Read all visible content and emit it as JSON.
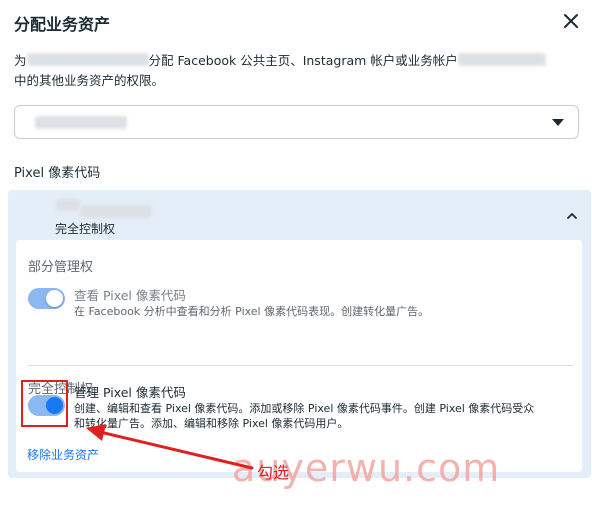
{
  "dialog": {
    "title": "分配业务资产",
    "desc_prefix": "为",
    "desc_middle": "分配 Facebook 公共主页、Instagram 帐户或业务帐户",
    "desc_suffix": "中的其他业务资产的权限。"
  },
  "section": {
    "label": "Pixel 像素代码"
  },
  "panel": {
    "role_label": "完全控制权",
    "partial": {
      "title": "部分管理权",
      "permission_name": "查看 Pixel 像素代码",
      "permission_desc": "在 Facebook 分析中查看和分析 Pixel 像素代码表现。创建转化量广告。",
      "enabled": true
    },
    "full": {
      "title": "完全控制权",
      "permission_name": "管理 Pixel 像素代码",
      "permission_desc_line1": "创建、编辑和查看 Pixel 像素代码。添加或移除 Pixel 像素代码事件。创建 Pixel 像素代码受众",
      "permission_desc_line2": "和转化量广告。添加、编辑和移除 Pixel 像素代码用户。",
      "enabled": true
    },
    "remove_link": "移除业务资产"
  },
  "annotation": {
    "label": "勾选"
  },
  "watermark": "auyerwu.com",
  "colors": {
    "accent": "#1877f2",
    "toggle_on": "#1877f2",
    "toggle_light": "#8bb8f0",
    "panel_bg": "#e4eef8",
    "annotation": "#e02020"
  },
  "icons": {
    "close": "close-icon",
    "select_caret": "caret-down-icon",
    "collapse": "chevron-up-icon"
  }
}
